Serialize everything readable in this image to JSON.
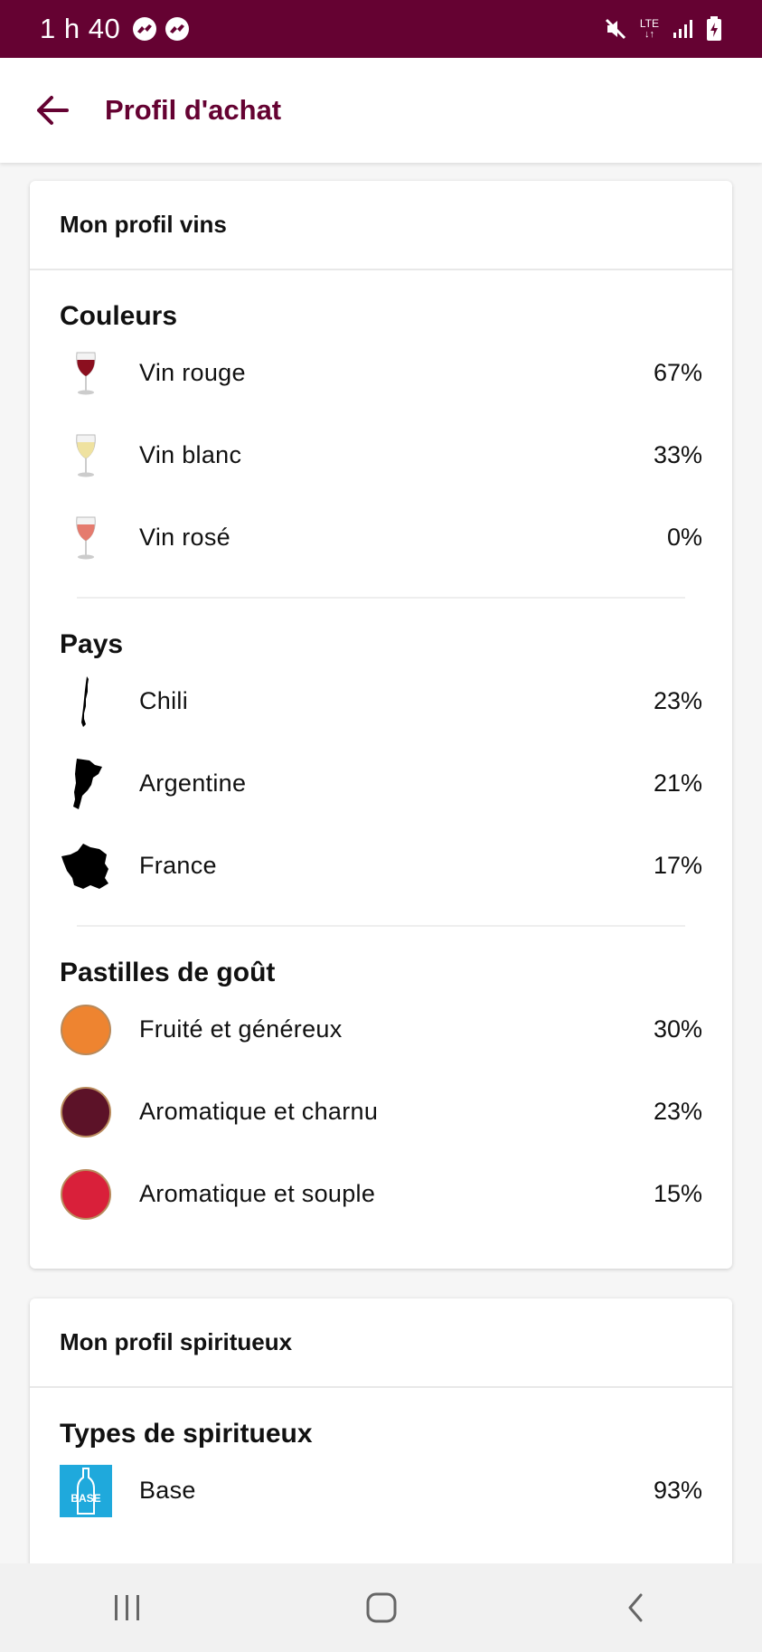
{
  "status_bar": {
    "time": "1 h 40",
    "network": "LTE",
    "background_color": "#650232"
  },
  "app_bar": {
    "title": "Profil d'achat",
    "back_icon": "arrow-left-icon",
    "accent_color": "#650232"
  },
  "wine_profile": {
    "header": "Mon profil vins",
    "colors": {
      "title": "Couleurs",
      "items": [
        {
          "label": "Vin rouge",
          "value": "67%",
          "icon": "red-wine-glass-icon"
        },
        {
          "label": "Vin blanc",
          "value": "33%",
          "icon": "white-wine-glass-icon"
        },
        {
          "label": "Vin rosé",
          "value": "0%",
          "icon": "rose-wine-glass-icon"
        }
      ]
    },
    "countries": {
      "title": "Pays",
      "items": [
        {
          "label": "Chili",
          "value": "23%",
          "icon": "chile-map-icon"
        },
        {
          "label": "Argentine",
          "value": "21%",
          "icon": "argentina-map-icon"
        },
        {
          "label": "France",
          "value": "17%",
          "icon": "france-map-icon"
        }
      ]
    },
    "taste_tags": {
      "title": "Pastilles de goût",
      "items": [
        {
          "label": "Fruité et généreux",
          "value": "30%",
          "color": "#ee8430"
        },
        {
          "label": "Aromatique et charnu",
          "value": "23%",
          "color": "#5c1228"
        },
        {
          "label": "Aromatique et souple",
          "value": "15%",
          "color": "#d9203a"
        }
      ]
    }
  },
  "spirits_profile": {
    "header": "Mon profil spiritueux",
    "types": {
      "title": "Types de spiritueux",
      "items": [
        {
          "label": "Base",
          "value": "93%",
          "icon": "base-bottle-icon",
          "icon_text": "BASE",
          "color": "#1fa9dc"
        }
      ]
    }
  },
  "nav_bar": {
    "recents_icon": "recents-icon",
    "home_icon": "home-icon",
    "back_icon": "back-chevron-icon"
  }
}
